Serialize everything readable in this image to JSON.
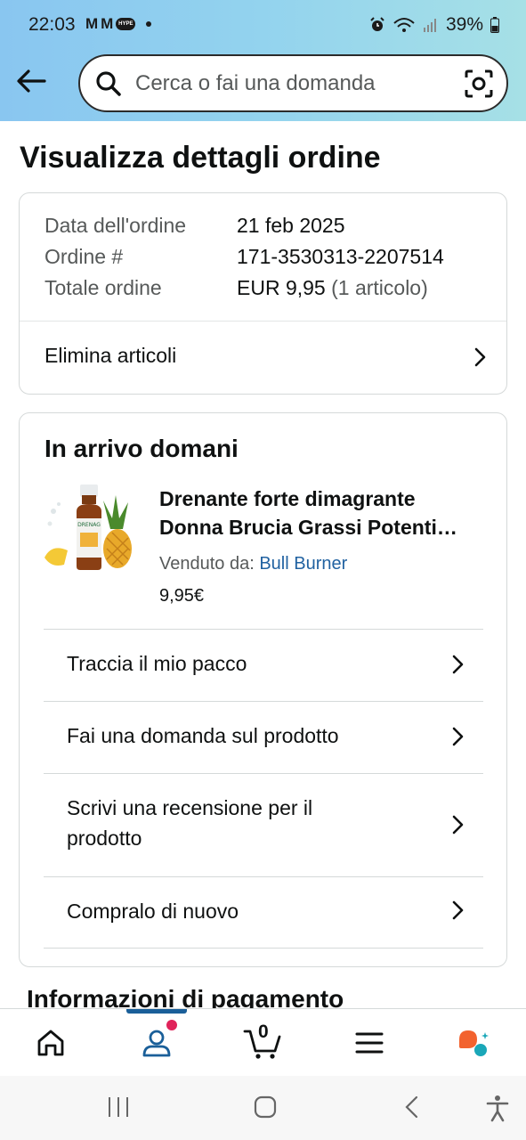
{
  "status_bar": {
    "time": "22:03",
    "battery": "39%",
    "hype_badge": "HYPE"
  },
  "search": {
    "placeholder": "Cerca o fai una domanda"
  },
  "page_title": "Visualizza dettagli ordine",
  "order_summary": {
    "rows": [
      {
        "label": "Data dell'ordine",
        "value": "21 feb 2025"
      },
      {
        "label": "Ordine #",
        "value": "171-3530313-2207514"
      },
      {
        "label": "Totale ordine",
        "value": "EUR 9,95",
        "extra": "(1 articolo)"
      }
    ],
    "remove_items_label": "Elimina articoli"
  },
  "shipment": {
    "heading": "In arrivo domani",
    "product": {
      "title_line1": "Drenante forte dimagrante",
      "title_line2": "Donna Brucia Grassi Potenti…",
      "sold_by_label": "Venduto da:",
      "seller": "Bull Burner",
      "price": "9,95€",
      "bottle_label": "DRENAG"
    },
    "actions": [
      {
        "label": "Traccia il mio pacco"
      },
      {
        "label": "Fai una domanda sul prodotto"
      },
      {
        "label_line1": "Scrivi una recensione per il",
        "label_line2": "prodotto"
      },
      {
        "label": "Compralo di nuovo"
      }
    ]
  },
  "payment_heading": "Informazioni di pagamento",
  "bottom_nav": {
    "cart_count": "0",
    "active": "account"
  },
  "colors": {
    "header_start": "#89c6f0",
    "header_end": "#a6e0e6",
    "link": "#2162a1",
    "nav_active": "#1a5f99",
    "notification": "#e0235a",
    "rufus_orange": "#f2622e",
    "rufus_teal": "#1aa7b8"
  }
}
